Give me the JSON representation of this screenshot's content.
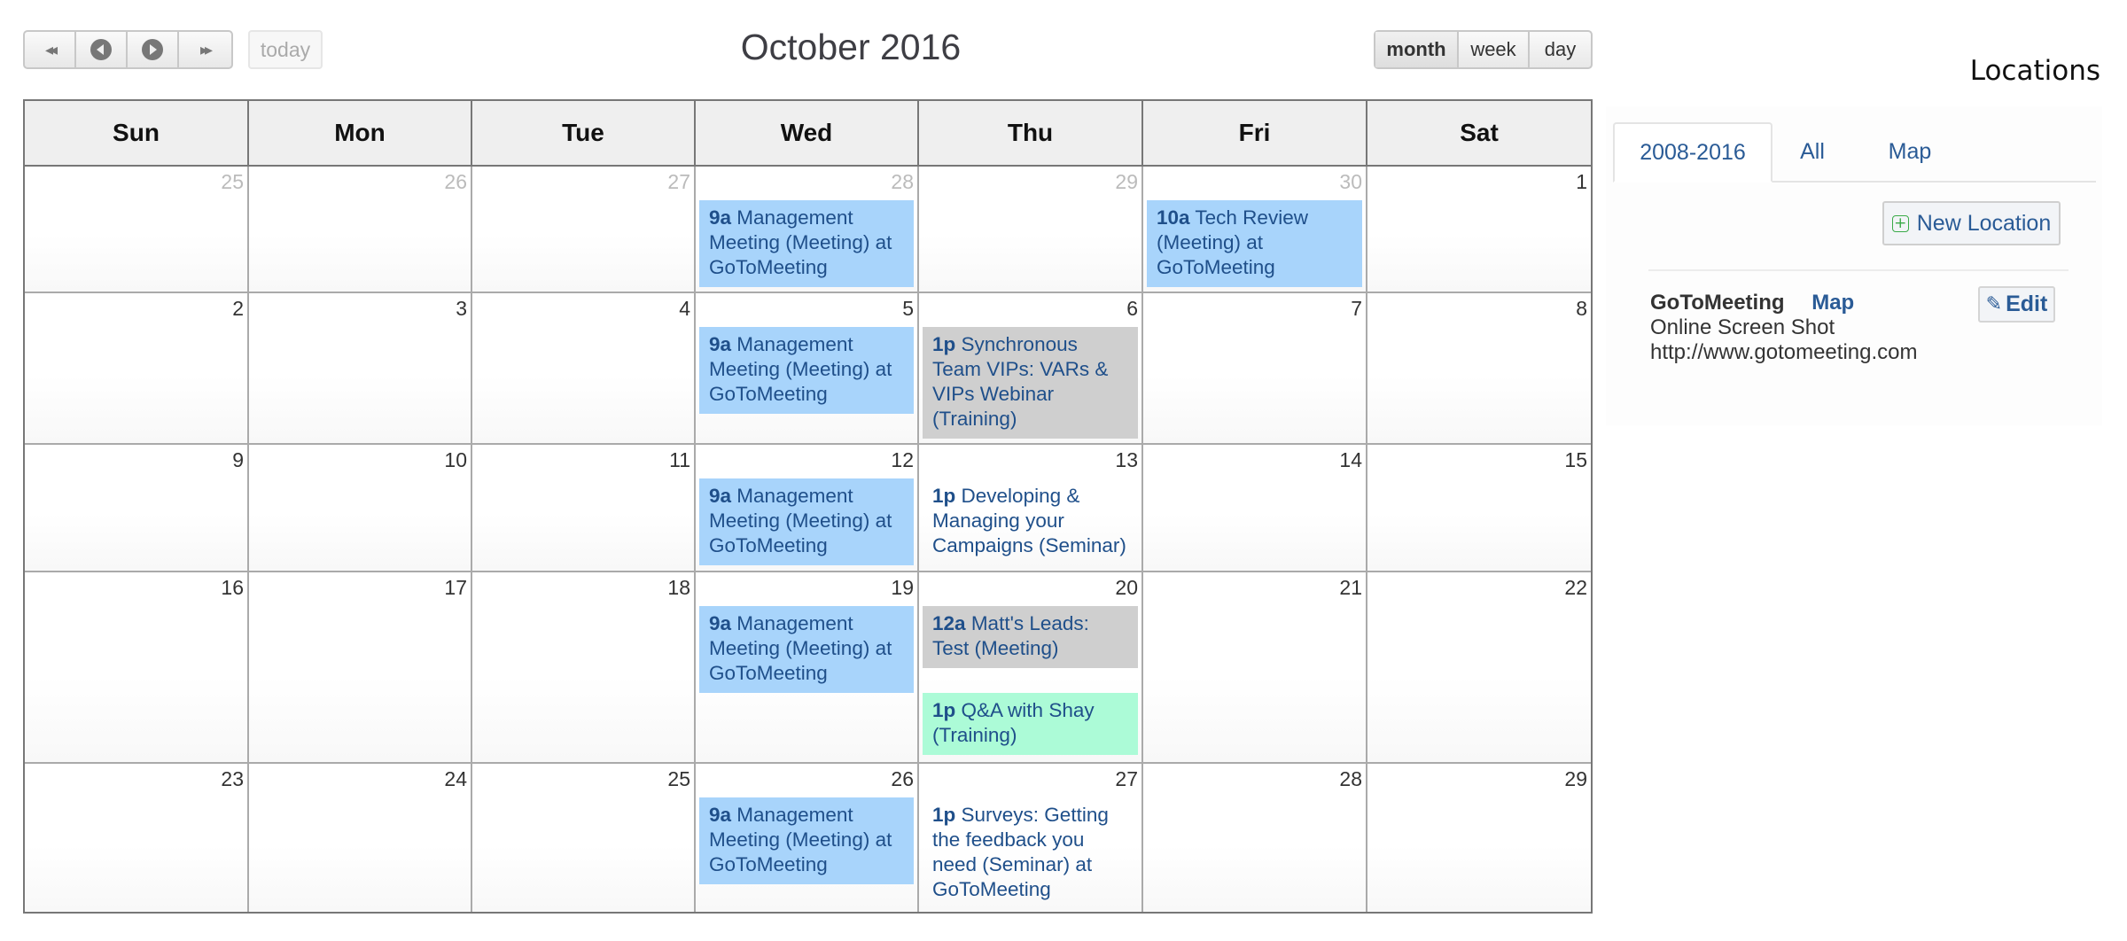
{
  "toolbar": {
    "prev_year_label": "<<",
    "next_year_label": ">>",
    "today_label": "today",
    "title": "October 2016",
    "views": [
      {
        "label": "month",
        "active": true
      },
      {
        "label": "week",
        "active": false
      },
      {
        "label": "day",
        "active": false
      }
    ]
  },
  "calendar": {
    "weekdays": [
      "Sun",
      "Mon",
      "Tue",
      "Wed",
      "Thu",
      "Fri",
      "Sat"
    ],
    "colors": {
      "meeting_blue": "#a8d4fb",
      "grey": "#cfcfcf",
      "green": "#acfbd7",
      "event_text": "#1f4f8a"
    },
    "weeks": [
      [
        {
          "day": "25",
          "other": true,
          "events": []
        },
        {
          "day": "26",
          "other": true,
          "events": []
        },
        {
          "day": "27",
          "other": true,
          "events": []
        },
        {
          "day": "28",
          "other": true,
          "events": [
            {
              "time": "9a",
              "title": "Management Meeting (Meeting) at GoToMeeting",
              "color": "blue"
            }
          ]
        },
        {
          "day": "29",
          "other": true,
          "events": []
        },
        {
          "day": "30",
          "other": true,
          "events": [
            {
              "time": "10a",
              "title": "Tech Review (Meeting) at GoToMeeting",
              "color": "blue"
            }
          ]
        },
        {
          "day": "1",
          "other": false,
          "events": []
        }
      ],
      [
        {
          "day": "2",
          "other": false,
          "events": []
        },
        {
          "day": "3",
          "other": false,
          "events": []
        },
        {
          "day": "4",
          "other": false,
          "events": []
        },
        {
          "day": "5",
          "other": false,
          "events": [
            {
              "time": "9a",
              "title": "Management Meeting (Meeting) at GoToMeeting",
              "color": "blue"
            }
          ]
        },
        {
          "day": "6",
          "other": false,
          "events": [
            {
              "time": "1p",
              "title": "Synchronous Team VIPs: VARs & VIPs Webinar (Training)",
              "color": "grey"
            }
          ]
        },
        {
          "day": "7",
          "other": false,
          "events": []
        },
        {
          "day": "8",
          "other": false,
          "events": []
        }
      ],
      [
        {
          "day": "9",
          "other": false,
          "events": []
        },
        {
          "day": "10",
          "other": false,
          "events": []
        },
        {
          "day": "11",
          "other": false,
          "events": []
        },
        {
          "day": "12",
          "other": false,
          "events": [
            {
              "time": "9a",
              "title": "Management Meeting (Meeting) at GoToMeeting",
              "color": "blue"
            }
          ]
        },
        {
          "day": "13",
          "other": false,
          "events": [
            {
              "time": "1p",
              "title": "Developing & Managing your Campaigns (Seminar)",
              "color": "none"
            }
          ]
        },
        {
          "day": "14",
          "other": false,
          "events": []
        },
        {
          "day": "15",
          "other": false,
          "events": []
        }
      ],
      [
        {
          "day": "16",
          "other": false,
          "events": []
        },
        {
          "day": "17",
          "other": false,
          "events": []
        },
        {
          "day": "18",
          "other": false,
          "events": []
        },
        {
          "day": "19",
          "other": false,
          "events": [
            {
              "time": "9a",
              "title": "Management Meeting (Meeting) at GoToMeeting",
              "color": "blue"
            }
          ]
        },
        {
          "day": "20",
          "other": false,
          "events": [
            {
              "time": "12a",
              "title": "Matt's Leads: Test (Meeting)",
              "color": "grey"
            },
            {
              "time": "1p",
              "title": "Q&A with Shay (Training)",
              "color": "green"
            }
          ]
        },
        {
          "day": "21",
          "other": false,
          "events": []
        },
        {
          "day": "22",
          "other": false,
          "events": []
        }
      ],
      [
        {
          "day": "23",
          "other": false,
          "events": []
        },
        {
          "day": "24",
          "other": false,
          "events": []
        },
        {
          "day": "25",
          "other": false,
          "events": []
        },
        {
          "day": "26",
          "other": false,
          "events": [
            {
              "time": "9a",
              "title": "Management Meeting (Meeting) at GoToMeeting",
              "color": "blue"
            }
          ]
        },
        {
          "day": "27",
          "other": false,
          "events": [
            {
              "time": "1p",
              "title": "Surveys: Getting the feedback you need (Seminar) at GoToMeeting",
              "color": "none"
            }
          ]
        },
        {
          "day": "28",
          "other": false,
          "events": []
        },
        {
          "day": "29",
          "other": false,
          "events": []
        }
      ]
    ]
  },
  "sidebar": {
    "title": "Locations",
    "tabs": [
      {
        "label": "2008-2016",
        "active": true
      },
      {
        "label": "All",
        "active": false
      },
      {
        "label": "Map",
        "active": false
      }
    ],
    "new_location_label": "New Location",
    "location": {
      "name": "GoToMeeting",
      "map_link": "Map",
      "description": "Online Screen Shot",
      "url": "http://www.gotomeeting.com",
      "edit_label": "Edit"
    },
    "colors": {
      "link": "#2a5b96",
      "plus_icon": "#3aaa48"
    }
  }
}
